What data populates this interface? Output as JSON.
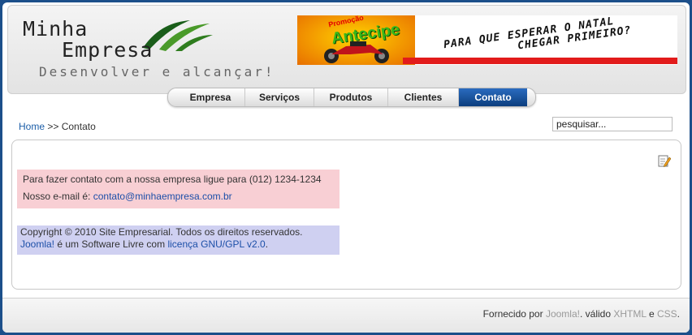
{
  "header": {
    "logo_line1": "Minha",
    "logo_line2": "Empresa",
    "logo_tagline": "Desenvolver e alcançar!"
  },
  "banner": {
    "promo_small": "Promoção",
    "promo_big": "Antecipe",
    "headline_1": "PARA QUE ESPERAR O NATAL",
    "headline_2": "CHEGAR PRIMEIRO?"
  },
  "nav": {
    "items": [
      {
        "label": "Empresa"
      },
      {
        "label": "Serviços"
      },
      {
        "label": "Produtos"
      },
      {
        "label": "Clientes"
      },
      {
        "label": "Contato"
      }
    ],
    "active": "Contato"
  },
  "breadcrumb": {
    "home": "Home",
    "separator": ">>",
    "current": "Contato"
  },
  "search": {
    "value": "pesquisar..."
  },
  "contact": {
    "line1": "Para fazer contato com a nossa empresa ligue para (012) 1234-1234",
    "email_prefix": "Nosso e-mail é:",
    "email": "contato@minhaempresa.com.br"
  },
  "copyright": {
    "line1": "Copyright © 2010 Site Empresarial. Todos os direitos reservados.",
    "joomla_link": "Joomla!",
    "middle": "é um Software Livre com",
    "license_link": "licença GNU/GPL v2.0",
    "end": "."
  },
  "footer": {
    "prefix": "Fornecido por",
    "joomla": "Joomla!",
    "valid": ". válido",
    "xhtml": "XHTML",
    "and": "e",
    "css": "CSS",
    "end": "."
  },
  "colors": {
    "nav_active": "#0c3e7e",
    "contact_bg": "#f8cfd4",
    "copyright_bg": "#cfd0f1",
    "link": "#1c5ea8"
  }
}
